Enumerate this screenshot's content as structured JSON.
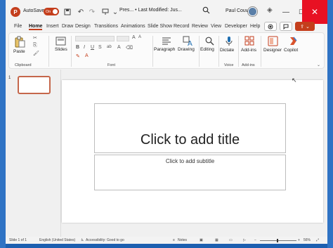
{
  "titlebar": {
    "logo_letter": "P",
    "autosave_label": "AutoSave",
    "autosave_state": "On",
    "doc_title": "Pres... • Last Modified: Jus...",
    "user_name": "Paul Couvert",
    "icons": [
      "save-icon",
      "undo-icon",
      "redo-icon",
      "present-icon",
      "more-icon",
      "search-icon",
      "diamond-icon",
      "minimize-icon",
      "maximize-icon",
      "close-icon"
    ]
  },
  "tabs": [
    "File",
    "Home",
    "Insert",
    "Draw",
    "Design",
    "Transitions",
    "Animations",
    "Slide Show",
    "Record",
    "Review",
    "View",
    "Developer",
    "Help"
  ],
  "ribbon": {
    "clipboard": {
      "paste": "Paste",
      "group": "Clipboard"
    },
    "slides": {
      "label": "Slides"
    },
    "font": {
      "group": "Font",
      "format": [
        "B",
        "I",
        "U",
        "S",
        "ab",
        "A"
      ]
    },
    "paragraph": {
      "label": "Paragraph"
    },
    "drawing": {
      "label": "Drawing"
    },
    "editing": {
      "label": "Editing"
    },
    "dictate": {
      "label": "Dictate",
      "group": "Voice"
    },
    "addins": {
      "label": "Add-ins",
      "group": "Add-ins"
    },
    "designer": {
      "label": "Designer"
    },
    "copilot": {
      "label": "Copilot"
    }
  },
  "thumbnails": {
    "number": "1"
  },
  "slide": {
    "title_placeholder": "Click to add title",
    "subtitle_placeholder": "Click to add subtitle"
  },
  "status": {
    "slide_count": "Slide 1 of 1",
    "language": "English (United States)",
    "accessibility": "Accessibility: Good to go",
    "notes": "Notes",
    "zoom": "56%"
  },
  "colors": {
    "accent": "#c43e1c",
    "close": "#e81123"
  }
}
